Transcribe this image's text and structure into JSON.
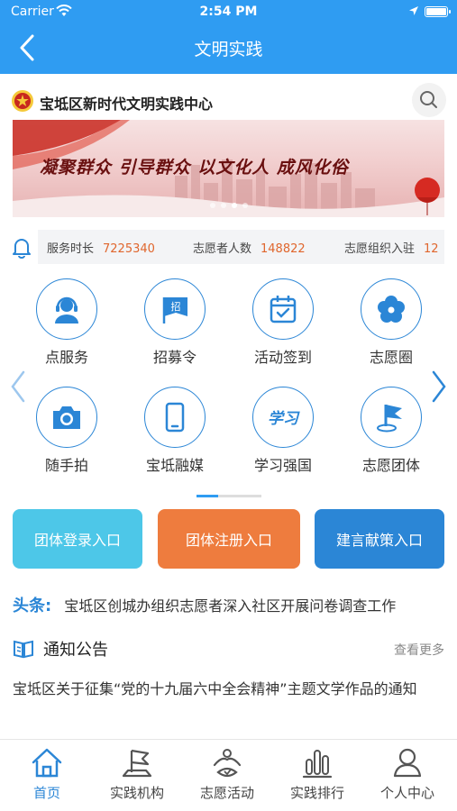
{
  "status_bar": {
    "carrier": "Carrier",
    "time": "2:54 PM"
  },
  "nav": {
    "title": "文明实践"
  },
  "site": {
    "title": "宝坻区新时代文明实践中心"
  },
  "banner": {
    "slogan": "凝聚群众 引导群众 以文化人 成风化俗"
  },
  "stats": [
    {
      "label": "服务时长",
      "value": "7225340"
    },
    {
      "label": "志愿者人数",
      "value": "148822"
    },
    {
      "label": "志愿组织入驻",
      "value": "12"
    }
  ],
  "grid": [
    {
      "label": "点服务",
      "icon": "headset-user-icon"
    },
    {
      "label": "招募令",
      "icon": "recruit-flag-icon",
      "badge": "招"
    },
    {
      "label": "活动签到",
      "icon": "calendar-check-icon"
    },
    {
      "label": "志愿圈",
      "icon": "flower-icon"
    },
    {
      "label": "随手拍",
      "icon": "camera-icon"
    },
    {
      "label": "宝坻融媒",
      "icon": "phone-icon"
    },
    {
      "label": "学习强国",
      "icon": "xuexi-logo-icon",
      "badge": "学习"
    },
    {
      "label": "志愿团体",
      "icon": "flag-pin-icon"
    }
  ],
  "entries": [
    {
      "label": "团体登录入口",
      "color": "#4dc7e8"
    },
    {
      "label": "团体注册入口",
      "color": "#ee7c3e"
    },
    {
      "label": "建言献策入口",
      "color": "#2b86d6"
    }
  ],
  "headline": {
    "tag": "头条:",
    "text": "宝坻区创城办组织志愿者深入社区开展问卷调查工作"
  },
  "notice": {
    "title": "通知公告",
    "more": "查看更多",
    "text": "宝坻区关于征集“党的十九届六中全会精神”主题文学作品的通知"
  },
  "tabs": [
    {
      "label": "首页",
      "icon": "home-icon",
      "active": true
    },
    {
      "label": "实践机构",
      "icon": "institution-flag-icon"
    },
    {
      "label": "志愿活动",
      "icon": "volunteer-activity-icon"
    },
    {
      "label": "实践排行",
      "icon": "ranking-bars-icon"
    },
    {
      "label": "个人中心",
      "icon": "user-icon"
    }
  ],
  "colors": {
    "primary": "#2f9cf2",
    "accent": "#2b86d6",
    "number": "#e0662d"
  }
}
